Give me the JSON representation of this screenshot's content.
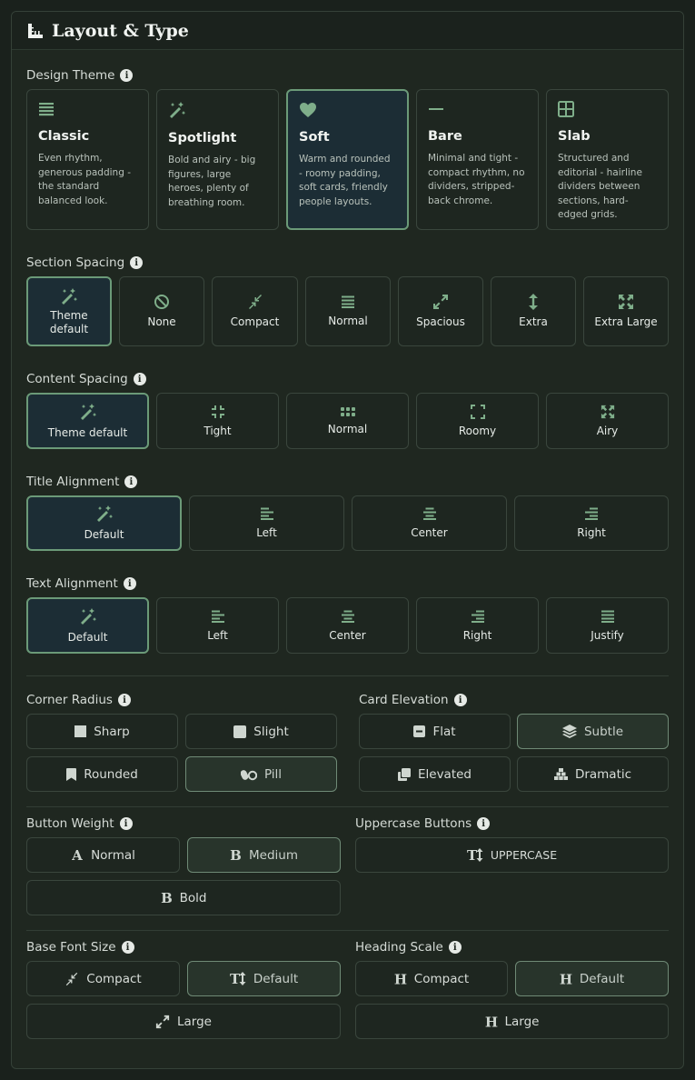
{
  "header": {
    "title": "Layout & Type",
    "icon": "ruler-icon"
  },
  "design_theme": {
    "label": "Design Theme",
    "options": [
      {
        "name": "Classic",
        "desc": "Even rhythm, generous padding - the standard balanced look.",
        "icon": "lines-icon"
      },
      {
        "name": "Spotlight",
        "desc": "Bold and airy - big figures, large heroes, plenty of breathing room.",
        "icon": "magic-wand-icon"
      },
      {
        "name": "Soft",
        "desc": "Warm and rounded - roomy padding, soft cards, friendly people layouts.",
        "icon": "heart-icon"
      },
      {
        "name": "Bare",
        "desc": "Minimal and tight - compact rhythm, no dividers, stripped-back chrome.",
        "icon": "minus-icon"
      },
      {
        "name": "Slab",
        "desc": "Structured and editorial - hairline dividers between sections, hard-edged grids.",
        "icon": "grid-icon"
      }
    ],
    "selected": "Soft"
  },
  "section_spacing": {
    "label": "Section Spacing",
    "options": [
      "Theme default",
      "None",
      "Compact",
      "Normal",
      "Spacious",
      "Extra",
      "Extra Large"
    ],
    "selected": "Theme default"
  },
  "content_spacing": {
    "label": "Content Spacing",
    "options": [
      "Theme default",
      "Tight",
      "Normal",
      "Roomy",
      "Airy"
    ],
    "selected": "Theme default"
  },
  "title_alignment": {
    "label": "Title Alignment",
    "options": [
      "Default",
      "Left",
      "Center",
      "Right"
    ],
    "selected": "Default"
  },
  "text_alignment": {
    "label": "Text Alignment",
    "options": [
      "Default",
      "Left",
      "Center",
      "Right",
      "Justify"
    ],
    "selected": "Default"
  },
  "corner_radius": {
    "label": "Corner Radius",
    "options": [
      "Sharp",
      "Slight",
      "Rounded",
      "Pill"
    ],
    "selected": "Pill"
  },
  "card_elevation": {
    "label": "Card Elevation",
    "options": [
      "Flat",
      "Subtle",
      "Elevated",
      "Dramatic"
    ],
    "selected": "Subtle"
  },
  "button_weight": {
    "label": "Button Weight",
    "options": [
      "Normal",
      "Medium",
      "Bold"
    ],
    "selected": "Medium"
  },
  "uppercase_buttons": {
    "label": "Uppercase Buttons",
    "options": [
      "UPPERCASE"
    ]
  },
  "base_font_size": {
    "label": "Base Font Size",
    "options": [
      "Compact",
      "Default",
      "Large"
    ],
    "selected": "Default"
  },
  "heading_scale": {
    "label": "Heading Scale",
    "options": [
      "Compact",
      "Default",
      "Large"
    ],
    "selected": "Default"
  },
  "colors": {
    "accent": "#6b9a78",
    "icon": "#7fae8a",
    "selected_bg": "#1c2d35"
  }
}
